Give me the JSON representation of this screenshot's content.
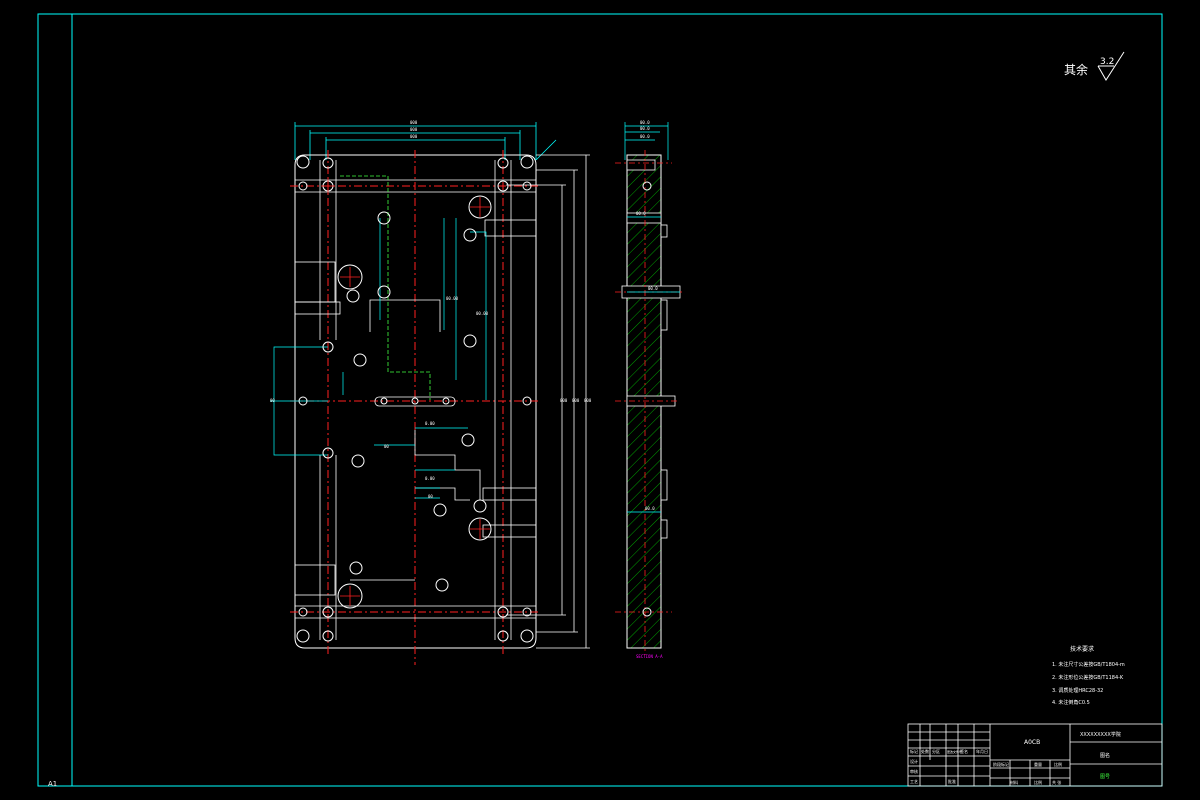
{
  "roughness_note": {
    "label": "其余",
    "value": "3.2"
  },
  "tech_requirements": {
    "title": "技术要求",
    "items": [
      "1. 未注尺寸公差按GB/T1804-m",
      "2. 未注形位公差按GB/T1184-K",
      "3. 调质处理HRC28-32",
      "4. 未注倒角C0.5"
    ]
  },
  "title_block": {
    "part_name": "A0CB",
    "school": "XXXXXXXXX学院",
    "drawing_name": "图名",
    "drawing_no": "图号",
    "material_label": "材料",
    "ratio_label": "比例",
    "sheet_label": "共 张",
    "labels_row": [
      "标记",
      "处数",
      "分区",
      "更改文件号",
      "签名",
      "年月日"
    ],
    "roles": [
      "设计",
      "审核",
      "工艺",
      "批准"
    ],
    "stage_headers": [
      "阶段标记",
      "重量",
      "比例"
    ]
  },
  "sheet_size": "A1",
  "side_view_label": "SECTION A-A",
  "colors": {
    "frame": "#00ffff",
    "outline": "#ffffff",
    "center": "#ff2020",
    "dimension": "#00ffff",
    "hatch": "#00c800",
    "green_line": "#40ff40",
    "magenta": "#ff00ff",
    "yellow": "#ffff00"
  }
}
